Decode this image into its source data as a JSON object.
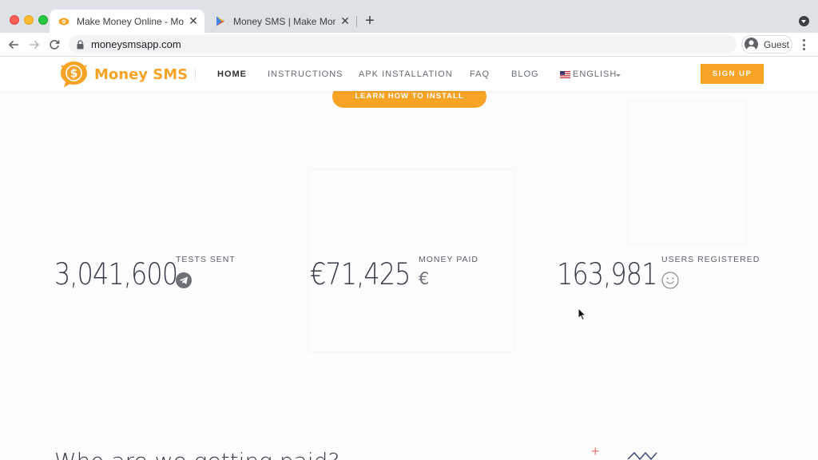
{
  "browser": {
    "tabs": [
      {
        "title": "Make Money Online - Money SMS",
        "active": true
      },
      {
        "title": "Money SMS | Make Money Online",
        "active": false
      }
    ],
    "url": "moneysmsapp.com",
    "profile_label": "Guest"
  },
  "site": {
    "logo_text": "Money SMS",
    "nav": [
      {
        "label": "HOME"
      },
      {
        "label": "INSTRUCTIONS"
      },
      {
        "label": "APK INSTALLATION"
      },
      {
        "label": "FAQ"
      },
      {
        "label": "BLOG"
      }
    ],
    "language": "ENGLISH",
    "signup_label": "SIGN UP",
    "install_button": "LEARN HOW TO INSTALL"
  },
  "stats": [
    {
      "value": "3,041,600",
      "label": "TESTS SENT",
      "icon": "telegram-icon"
    },
    {
      "value": "€71,425",
      "label": "MONEY PAID",
      "icon": "euro-icon",
      "symbol": "€"
    },
    {
      "value": "163,981",
      "label": "USERS REGISTERED",
      "icon": "smiley-icon"
    }
  ],
  "section_heading": "Who are we getting paid?",
  "colors": {
    "accent": "#f7a325",
    "text_dark": "#363c4a"
  }
}
